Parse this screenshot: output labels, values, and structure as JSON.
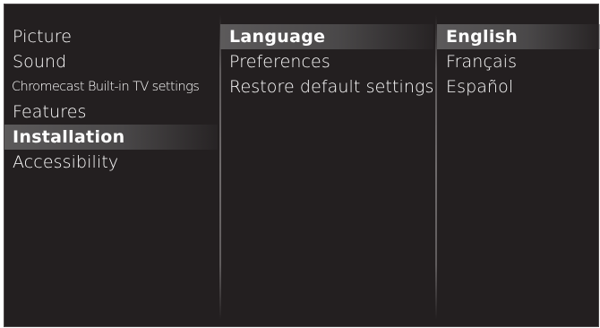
{
  "menus": {
    "main": {
      "items": [
        {
          "label": "Picture"
        },
        {
          "label": "Sound"
        },
        {
          "label": "Chromecast Built-in TV settings"
        },
        {
          "label": "Features"
        },
        {
          "label": "Installation"
        },
        {
          "label": "Accessibility"
        }
      ],
      "selected_label": "Installation"
    },
    "installation": {
      "items": [
        {
          "label": "Language"
        },
        {
          "label": "Preferences"
        },
        {
          "label": "Restore default settings"
        }
      ],
      "selected_label": "Language"
    },
    "language": {
      "items": [
        {
          "label": "English"
        },
        {
          "label": "Français"
        },
        {
          "label": "Español"
        }
      ],
      "selected_label": "English"
    }
  },
  "colors": {
    "background": "#231f20",
    "text": "#ffffff",
    "highlight": "#5c5a5b"
  }
}
